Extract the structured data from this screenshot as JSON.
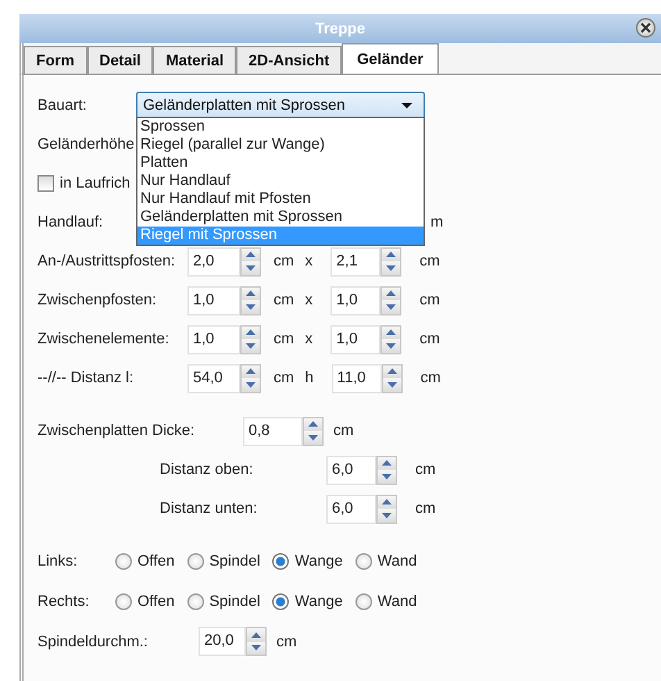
{
  "window": {
    "title": "Treppe"
  },
  "tabs": [
    {
      "label": "Form",
      "selected": false
    },
    {
      "label": "Detail",
      "selected": false
    },
    {
      "label": "Material",
      "selected": false
    },
    {
      "label": "2D-Ansicht",
      "selected": false
    },
    {
      "label": "Geländer",
      "selected": true
    }
  ],
  "bauart": {
    "label": "Bauart:",
    "value": "Geländerplatten mit Sprossen",
    "expanded": true,
    "options": [
      {
        "label": "Sprossen",
        "highlighted": false
      },
      {
        "label": "Riegel (parallel zur Wange)",
        "highlighted": false
      },
      {
        "label": "Platten",
        "highlighted": false
      },
      {
        "label": "Nur Handlauf",
        "highlighted": false
      },
      {
        "label": "Nur Handlauf mit Pfosten",
        "highlighted": false
      },
      {
        "label": "Geländerplatten mit Sprossen",
        "highlighted": false
      },
      {
        "label": "Riegel mit Sprossen",
        "highlighted": true
      }
    ]
  },
  "gelaenderhoehe": {
    "label": "Geländerhöhe"
  },
  "laufrichtung": {
    "label": "in Laufrich",
    "checked": false
  },
  "handlauf": {
    "label": "Handlauf:",
    "unit": "m"
  },
  "dimension_rows": [
    {
      "label": "An-/Austrittspfosten:",
      "value_1": "2,0",
      "unit_1": "cm",
      "separator": "x",
      "value_2": "2,1",
      "unit_2": "cm"
    },
    {
      "label": "Zwischenpfosten:",
      "value_1": "1,0",
      "unit_1": "cm",
      "separator": "x",
      "value_2": "1,0",
      "unit_2": "cm"
    },
    {
      "label": "Zwischenelemente:",
      "value_1": "1,0",
      "unit_1": "cm",
      "separator": "x",
      "value_2": "1,0",
      "unit_2": "cm"
    },
    {
      "label": "--//-- Distanz l:",
      "value_1": "54,0",
      "unit_1": "cm",
      "separator": "h",
      "value_2": "11,0",
      "unit_2": "cm"
    }
  ],
  "zwischenplatten": {
    "label": "Zwischenplatten Dicke:",
    "value": "0,8",
    "unit": "cm"
  },
  "distanz_rows": [
    {
      "label": "Distanz oben:",
      "value": "6,0",
      "unit": "cm"
    },
    {
      "label": "Distanz unten:",
      "value": "6,0",
      "unit": "cm"
    }
  ],
  "radio_groups": [
    {
      "label": "Links:",
      "options": [
        {
          "label": "Offen",
          "selected": false
        },
        {
          "label": "Spindel",
          "selected": false
        },
        {
          "label": "Wange",
          "selected": true
        },
        {
          "label": "Wand",
          "selected": false
        }
      ]
    },
    {
      "label": "Rechts:",
      "options": [
        {
          "label": "Offen",
          "selected": false
        },
        {
          "label": "Spindel",
          "selected": false
        },
        {
          "label": "Wange",
          "selected": true
        },
        {
          "label": "Wand",
          "selected": false
        }
      ]
    }
  ],
  "spindel": {
    "label": "Spindeldurchm.:",
    "value": "20,0",
    "unit": "cm"
  }
}
